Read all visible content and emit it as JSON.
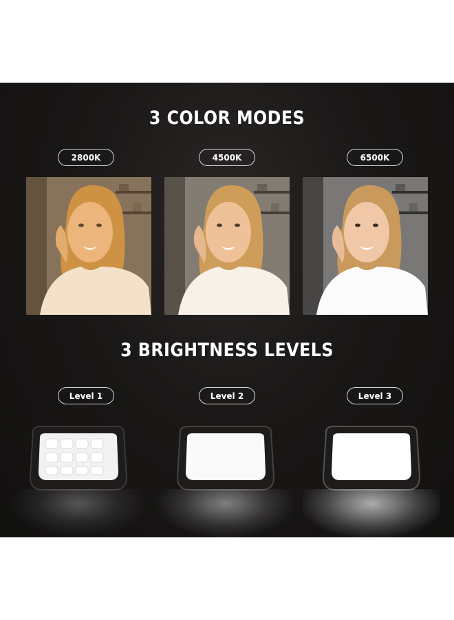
{
  "color_section": {
    "title": "3 COLOR MODES",
    "modes": [
      {
        "label": "2800K",
        "tint": "#f2b35c"
      },
      {
        "label": "4500K",
        "tint": "#f7d9a8"
      },
      {
        "label": "6500K",
        "tint": "#ffffff"
      }
    ]
  },
  "brightness_section": {
    "title": "3 BRIGHTNESS LEVELS",
    "levels": [
      {
        "label": "Level 1"
      },
      {
        "label": "Level 2"
      },
      {
        "label": "Level 3"
      }
    ]
  }
}
